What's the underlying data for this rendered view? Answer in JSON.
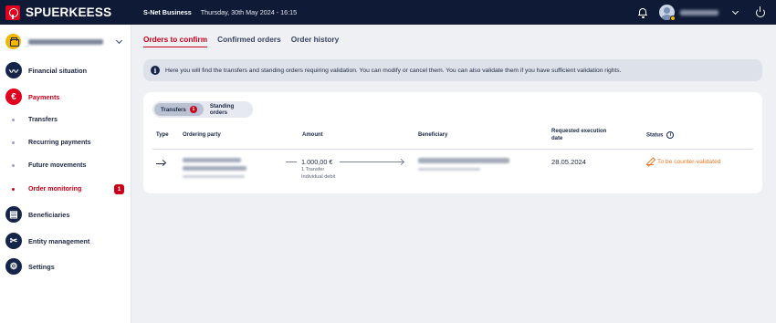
{
  "header": {
    "brand": "SPUERKEESS",
    "app_name": "S-Net Business",
    "datetime": "Thursday, 30th May 2024 - 16:15",
    "icons": [
      "bell-icon",
      "avatar",
      "chevron-down-icon",
      "power-icon"
    ]
  },
  "sidebar": {
    "items": [
      {
        "label": "Financial situation",
        "icon": "chart-icon"
      },
      {
        "label": "Payments",
        "icon": "payments-icon"
      },
      {
        "label": "Beneficiaries",
        "icon": "book-icon"
      },
      {
        "label": "Entity management",
        "icon": "tools-icon"
      },
      {
        "label": "Settings",
        "icon": "gear-icon"
      }
    ],
    "sub_items": [
      {
        "label": "Transfers"
      },
      {
        "label": "Recurring payments"
      },
      {
        "label": "Future movements"
      },
      {
        "label": "Order monitoring",
        "badge": "1"
      }
    ]
  },
  "tabs": [
    "Orders to confirm",
    "Confirmed orders",
    "Order history"
  ],
  "info_text": "Here you will find the transfers and standing orders requiring validation. You can modify or cancel them. You can also validate them if you have sufficient validation rights.",
  "segment": {
    "transfers": "Transfers",
    "transfers_badge": "1",
    "standing_orders": "Standing orders"
  },
  "table": {
    "headers": {
      "type": "Type",
      "ordering_party": "Ordering party",
      "amount": "Amount",
      "beneficiary": "Beneficiary",
      "requested_1": "Requested execution",
      "requested_2": "date",
      "status": "Status"
    },
    "row": {
      "amount": "1.000,00 €",
      "amount_sub1": "1 Transfer",
      "amount_sub2": "Individual debit",
      "date": "28.05.2024",
      "status": "To be counter-validated"
    }
  },
  "colors": {
    "accent": "#c8001a",
    "navy": "#0e1a36",
    "status_orange": "#e87722"
  }
}
